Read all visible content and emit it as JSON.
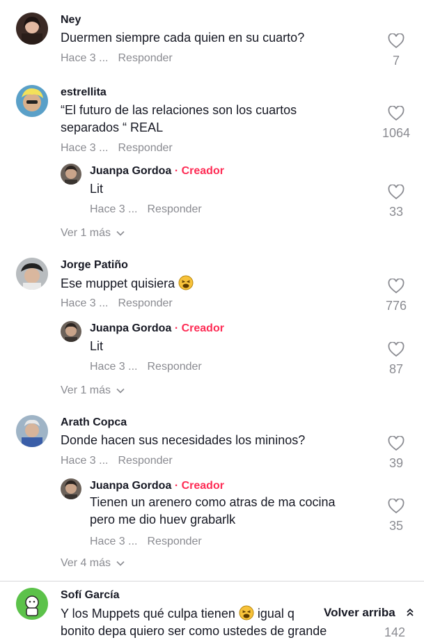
{
  "comments": [
    {
      "user": "Ney",
      "text": "Duermen siempre cada quien en su cuarto?",
      "time": "Hace 3 ...",
      "reply": "Responder",
      "likes": "7"
    },
    {
      "user": "estrellita",
      "text1": "“El futuro de las relaciones son los cuartos",
      "text2": "separados “ REAL",
      "time": "Hace 3 ...",
      "reply": "Responder",
      "likes": "1064"
    },
    {
      "user": "Juanpa Gordoa",
      "badge": "· Creador",
      "text": "Lit",
      "time": "Hace 3 ...",
      "reply": "Responder",
      "likes": "33"
    },
    {
      "user": "Jorge Patiño",
      "text": "Ese muppet quisiera",
      "time": "Hace 3 ...",
      "reply": "Responder",
      "likes": "776"
    },
    {
      "user": "Juanpa Gordoa",
      "badge": "· Creador",
      "text": "Lit",
      "time": "Hace 3 ...",
      "reply": "Responder",
      "likes": "87"
    },
    {
      "user": "Arath Copca",
      "text": "Donde hacen sus necesidades los mininos?",
      "time": "Hace 3 ...",
      "reply": "Responder",
      "likes": "39"
    },
    {
      "user": "Juanpa Gordoa",
      "badge": "· Creador",
      "text1": "Tienen un arenero como atras de ma cocina",
      "text2": "pero me dio huev grabarlk",
      "time": "Hace 3 ...",
      "reply": "Responder",
      "likes": "35"
    },
    {
      "user": "Sofí García",
      "text1a": "Y los Muppets qué culpa tienen",
      "text1b": "igual q",
      "text2": "bonito depa quiero ser como ustedes de grande",
      "likes": "142"
    }
  ],
  "view_more": [
    "Ver 1 más",
    "Ver 1 más",
    "Ver 4 más"
  ],
  "back_to_top": "Volver arriba",
  "icons": {
    "like": "heart-outline-icon",
    "chevron": "chevron-down-icon",
    "emoji": "weary-face-emoji",
    "back": "double-chevron-up-icon"
  },
  "colors": {
    "creator": "#fe2c55",
    "muted": "#8a8b91",
    "text": "#161823"
  }
}
